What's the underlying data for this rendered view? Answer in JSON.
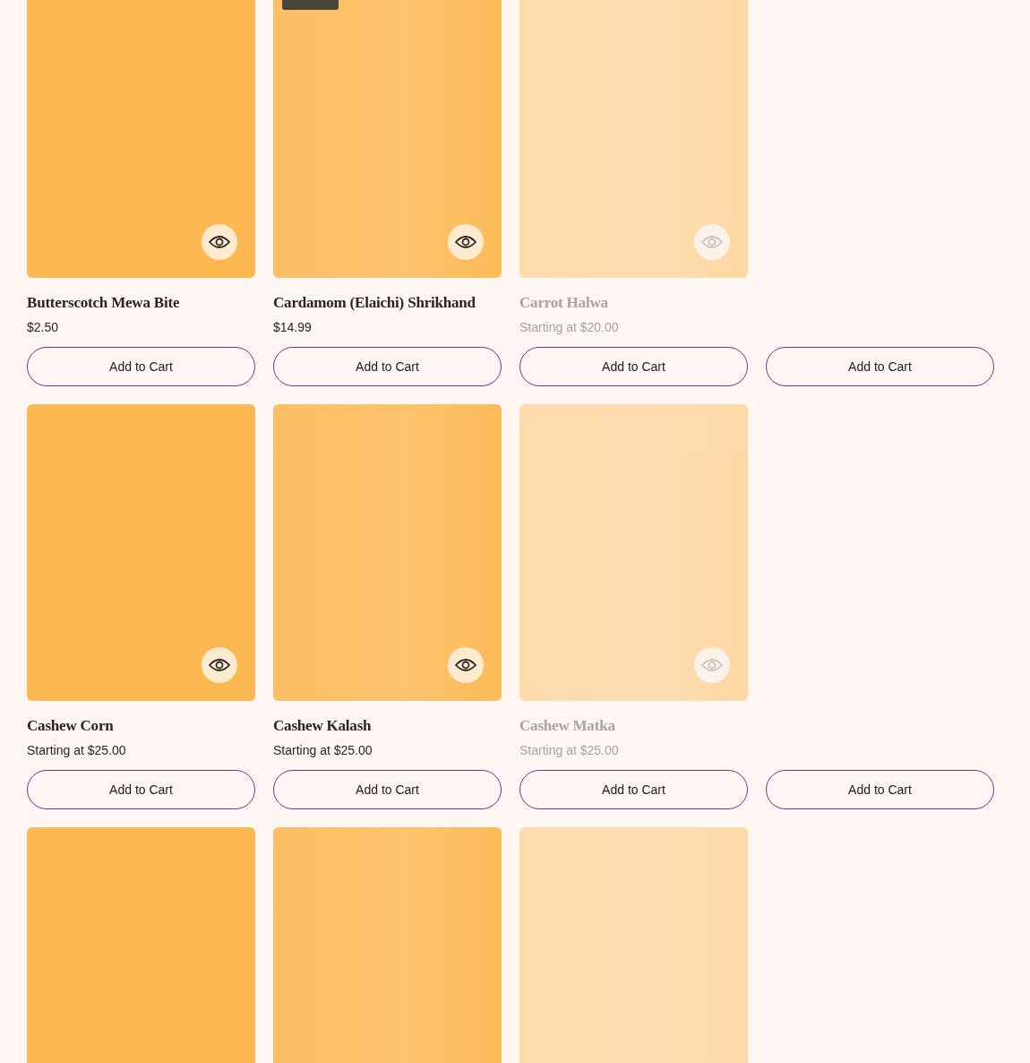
{
  "rows": [
    {
      "cards": [
        {
          "kind": "product",
          "title": "Butterscotch Mewa Bite",
          "price": "$2.50",
          "button": "Add to Cart",
          "faded": false,
          "badge": false
        },
        {
          "kind": "product",
          "title": "Cardamom (Elaichi) Shrikhand",
          "price": "$14.99",
          "button": "Add to Cart",
          "faded": false,
          "badge": true
        },
        {
          "kind": "product",
          "title": "Carrot Halwa",
          "price": "Starting at $20.00",
          "button": "Add to Cart",
          "faded": true,
          "badge": false
        },
        {
          "kind": "empty",
          "button": "Add to Cart"
        }
      ]
    },
    {
      "cards": [
        {
          "kind": "product",
          "title": "Cashew Corn",
          "price": "Starting at $25.00",
          "button": "Add to Cart",
          "faded": false,
          "badge": false
        },
        {
          "kind": "product",
          "title": "Cashew Kalash",
          "price": "Starting at $25.00",
          "button": "Add to Cart",
          "faded": false,
          "badge": false
        },
        {
          "kind": "product",
          "title": "Cashew Matka",
          "price": "Starting at $25.00",
          "button": "Add to Cart",
          "faded": true,
          "badge": false
        },
        {
          "kind": "empty",
          "button": "Add to Cart"
        }
      ]
    },
    {
      "cards": [
        {
          "kind": "product",
          "faded": false,
          "badge": false
        },
        {
          "kind": "product",
          "faded": false,
          "badge": false
        },
        {
          "kind": "product",
          "faded": true,
          "badge": false
        }
      ]
    }
  ]
}
